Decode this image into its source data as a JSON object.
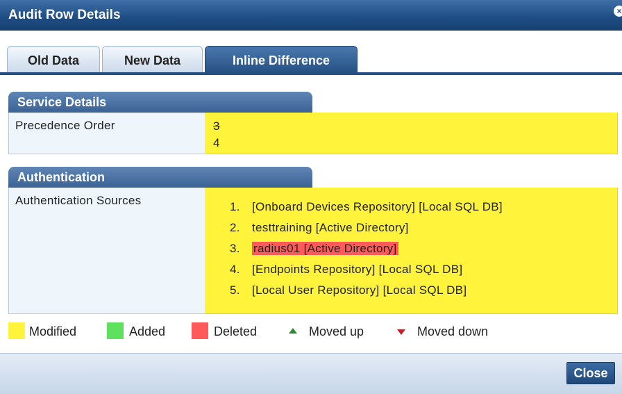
{
  "dialog": {
    "title": "Audit Row Details",
    "close_icon_glyph": "×"
  },
  "tabs": [
    {
      "label": "Old Data",
      "active": false
    },
    {
      "label": "New Data",
      "active": false
    },
    {
      "label": "Inline Difference",
      "active": true
    }
  ],
  "service_details": {
    "header": "Service Details",
    "rows": [
      {
        "label": "Precedence Order",
        "old_value": "3",
        "new_value": "4"
      }
    ]
  },
  "authentication": {
    "header": "Authentication",
    "label": "Authentication Sources",
    "sources": [
      {
        "num": "1.",
        "text": "[Onboard Devices Repository] [Local SQL DB]",
        "status": "modified"
      },
      {
        "num": "2.",
        "text": "testtraining [Active Directory]",
        "status": "modified"
      },
      {
        "num": "3.",
        "text": "radius01 [Active Directory]",
        "status": "deleted"
      },
      {
        "num": "4.",
        "text": "[Endpoints Repository] [Local SQL DB]",
        "status": "modified"
      },
      {
        "num": "5.",
        "text": "[Local User Repository] [Local SQL DB]",
        "status": "modified"
      }
    ]
  },
  "legend": [
    {
      "label": "Modified",
      "color": "#fff33b",
      "icon": "swatch"
    },
    {
      "label": "Added",
      "color": "#5fe05f",
      "icon": "swatch"
    },
    {
      "label": "Deleted",
      "color": "#ff5a5a",
      "icon": "swatch"
    },
    {
      "label": "Moved up",
      "color": "#2d8a2d",
      "icon": "triangle-up-icon"
    },
    {
      "label": "Moved down",
      "color": "#c0202a",
      "icon": "triangle-down-icon"
    }
  ],
  "footer": {
    "close_label": "Close"
  }
}
